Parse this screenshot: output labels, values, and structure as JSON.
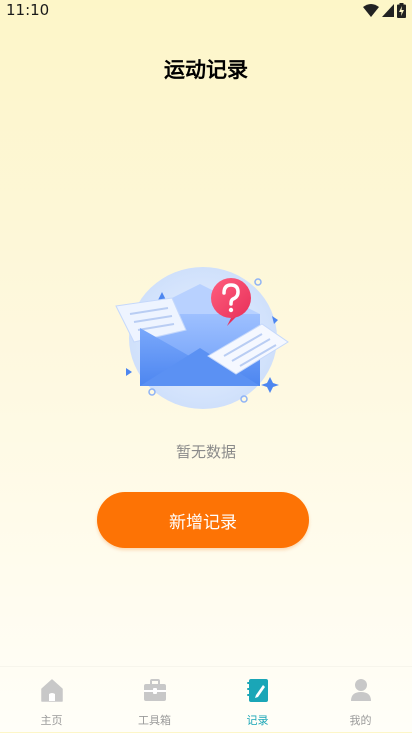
{
  "status_bar": {
    "time": "11:10"
  },
  "page": {
    "title": "运动记录"
  },
  "empty_state": {
    "message": "暂无数据"
  },
  "actions": {
    "add_record_label": "新增记录"
  },
  "tab_bar": {
    "active_color": "#1aa6b7",
    "inactive_color": "#c8c8c8",
    "tabs": [
      {
        "label": "主页",
        "icon": "home-icon",
        "active": false
      },
      {
        "label": "工具箱",
        "icon": "toolbox-icon",
        "active": false
      },
      {
        "label": "记录",
        "icon": "notebook-edit-icon",
        "active": true
      },
      {
        "label": "我的",
        "icon": "person-icon",
        "active": false
      }
    ]
  },
  "colors": {
    "accent": "#fd7305"
  }
}
